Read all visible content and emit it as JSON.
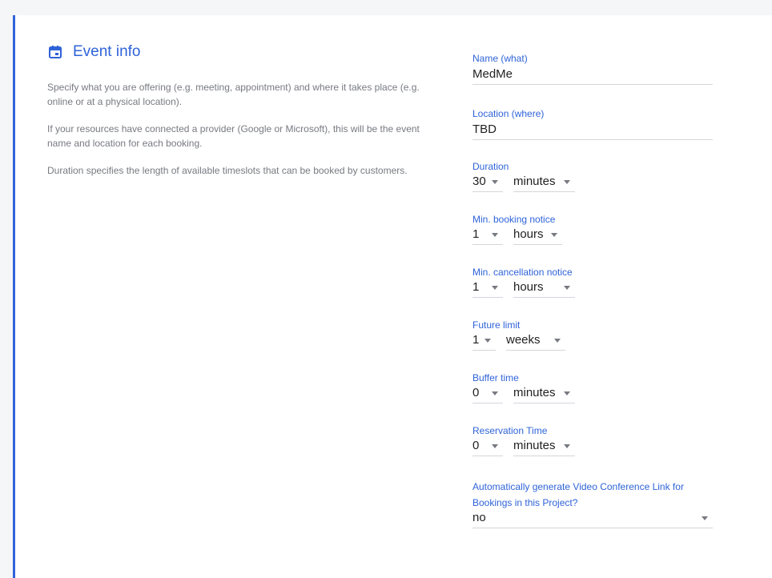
{
  "section": {
    "title": "Event info",
    "descriptions": [
      "Specify what you are offering (e.g. meeting, appointment) and where it takes place (e.g. online or at a physical location).",
      "If your resources have connected a provider (Google or Microsoft), this will be the event name and location for each booking.",
      "Duration specifies the length of available timeslots that can be booked by customers."
    ]
  },
  "fields": {
    "name": {
      "label": "Name (what)",
      "value": "MedMe"
    },
    "location": {
      "label": "Location (where)",
      "value": "TBD"
    },
    "duration": {
      "label": "Duration",
      "amount": "30",
      "unit": "minutes"
    },
    "min_booking": {
      "label": "Min. booking notice",
      "amount": "1",
      "unit": "hours"
    },
    "min_cancellation": {
      "label": "Min. cancellation notice",
      "amount": "1",
      "unit": "hours"
    },
    "future_limit": {
      "label": "Future limit",
      "amount": "1",
      "unit": "weeks"
    },
    "buffer_time": {
      "label": "Buffer time",
      "amount": "0",
      "unit": "minutes"
    },
    "reservation_time": {
      "label": "Reservation Time",
      "amount": "0",
      "unit": "minutes"
    },
    "video_conference": {
      "label": "Automatically generate Video Conference Link for Bookings in this Project?",
      "value": "no"
    }
  },
  "colors": {
    "accent": "#2f63d8",
    "muted_text": "#777a80",
    "underline": "#d3d6db"
  },
  "icons": {
    "section": "calendar-icon",
    "dropdown": "caret-down-icon"
  }
}
